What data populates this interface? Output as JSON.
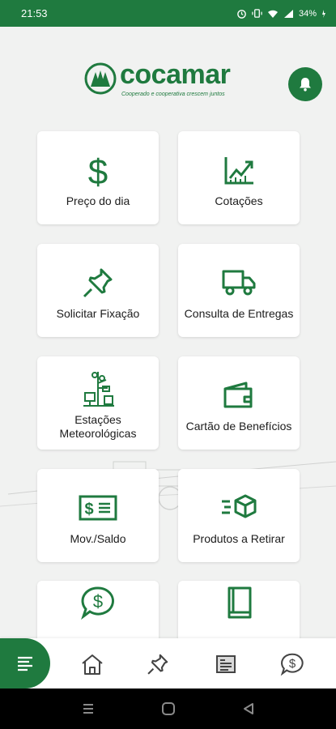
{
  "status_bar": {
    "time": "21:53",
    "battery": "34%",
    "icons": [
      "alarm-icon",
      "vibrate-icon",
      "wifi-icon",
      "signal-icon",
      "battery-icon"
    ]
  },
  "brand": {
    "name": "cocamar",
    "tagline": "Cooperado e cooperativa crescem juntos",
    "color": "#1f7a3f"
  },
  "header": {
    "notification_icon": "bell-icon"
  },
  "menu": {
    "items": [
      {
        "label": "Preço do dia",
        "icon": "dollar-icon"
      },
      {
        "label": "Cotações",
        "icon": "chart-trend-icon"
      },
      {
        "label": "Solicitar Fixação",
        "icon": "pushpin-icon"
      },
      {
        "label": "Consulta de Entregas",
        "icon": "truck-icon"
      },
      {
        "label": "Estações Meteorológicas",
        "icon": "weather-station-icon"
      },
      {
        "label": "Cartão de Benefícios",
        "icon": "wallet-icon"
      },
      {
        "label": "Mov./Saldo",
        "icon": "banknote-icon"
      },
      {
        "label": "Produtos a Retirar",
        "icon": "package-icon"
      },
      {
        "label": "",
        "icon": "dollar-chat-icon"
      },
      {
        "label": "",
        "icon": "book-icon"
      }
    ]
  },
  "bottom_nav": {
    "items": [
      "menu-icon",
      "home-icon",
      "pushpin-icon",
      "newspaper-icon",
      "dollar-chat-icon"
    ]
  },
  "system_nav": [
    "recents-icon",
    "home-circle-icon",
    "back-icon"
  ]
}
